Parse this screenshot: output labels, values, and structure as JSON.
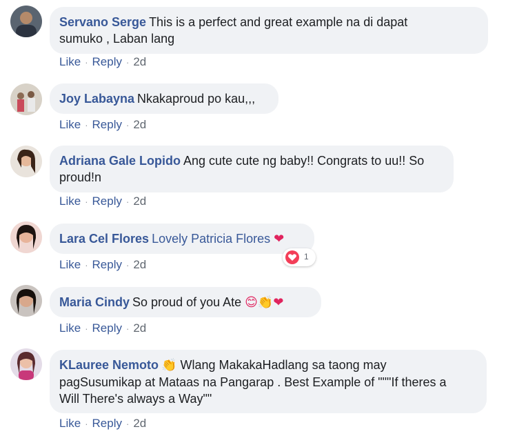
{
  "comments": [
    {
      "author": "Servano Serge",
      "text_line1": "This is a perfect and great example na di dapat",
      "text_line2": "sumuko , Laban lang",
      "actions": {
        "like": "Like",
        "reply": "Reply",
        "time": "2d"
      }
    },
    {
      "author": "Joy Labayna",
      "text": "Nkakaproud po kau,,,",
      "actions": {
        "like": "Like",
        "reply": "Reply",
        "time": "2d"
      }
    },
    {
      "author": "Adriana Gale Lopido",
      "text_line1": "Ang cute cute ng baby!! Congrats to uu!! So",
      "text_line2": "proud!n",
      "actions": {
        "like": "Like",
        "reply": "Reply",
        "time": "2d"
      }
    },
    {
      "author": "Lara Cel Flores",
      "tag": "Lovely Patricia Flores",
      "emoji": "❤",
      "reaction_count": "1",
      "actions": {
        "like": "Like",
        "reply": "Reply",
        "time": "2d"
      }
    },
    {
      "author": "Maria Cindy",
      "text": "So proud of you Ate",
      "emoji": "😊👏❤",
      "actions": {
        "like": "Like",
        "reply": "Reply",
        "time": "2d"
      }
    },
    {
      "author": "KLauree Nemoto",
      "emoji": "👏",
      "text_line1": "Wlang MakakaHadlang sa taong may",
      "text_line2": "pagSusumikap at Mataas na Pangarap . Best Example of \"\"\"If theres a",
      "text_line3": "Will There's always a Way\"\"",
      "actions": {
        "like": "Like",
        "reply": "Reply",
        "time": "2d"
      }
    }
  ],
  "icons": {
    "reaction": "heart-reaction-icon"
  },
  "colors": {
    "name": "#385898",
    "bubble": "#f0f2f5",
    "heart": "#f33e58"
  }
}
